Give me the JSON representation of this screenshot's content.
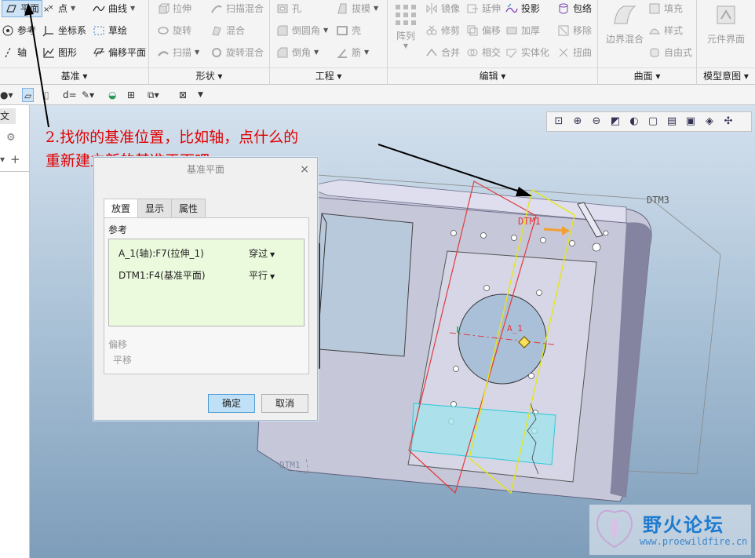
{
  "ribbon": {
    "datum": {
      "label": "基准",
      "plane": "平面",
      "point": "点",
      "curve": "曲线",
      "reference": "参考",
      "csys": "坐标系",
      "sketch": "草绘",
      "axis": "轴",
      "graph": "图形",
      "offset_plane": "偏移平面"
    },
    "shapes": {
      "label": "形状",
      "extrude": "拉伸",
      "sweep_blend": "扫描混合",
      "revolve": "旋转",
      "blend": "混合",
      "sweep": "扫描",
      "rotational_blend": "旋转混合"
    },
    "engineering": {
      "label": "工程",
      "hole": "孔",
      "draft": "拔模",
      "round": "倒圆角",
      "shell": "壳",
      "chamfer": "倒角",
      "rib": "筋"
    },
    "editing": {
      "label": "编辑",
      "pattern": "阵列",
      "mirror": "镜像",
      "extend": "延伸",
      "project": "投影",
      "wrap": "包络",
      "trim": "修剪",
      "offset": "偏移",
      "thicken": "加厚",
      "remove": "移除",
      "merge": "合并",
      "intersect": "相交",
      "solidify": "实体化",
      "twist": "扭曲"
    },
    "surfaces": {
      "label": "曲面",
      "boundary_blend": "边界混合",
      "fill": "填充",
      "style": "样式",
      "freestyle": "自由式"
    },
    "model_intent": {
      "label": "模型意图",
      "component_interface": "元件界面"
    }
  },
  "left_panel": {
    "tab_label": "文夹"
  },
  "annotation": {
    "line1": "2.找你的基准位置，比如轴，点什么的",
    "line2": "重新建立新的基准平面吧"
  },
  "dialog": {
    "title": "基准平面",
    "tabs": [
      "放置",
      "显示",
      "属性"
    ],
    "active_tab": "放置",
    "references_label": "参考",
    "references": [
      {
        "ref": "A_1(轴):F7(拉伸_1)",
        "constraint": "穿过"
      },
      {
        "ref": "DTM1:F4(基准平面)",
        "constraint": "平行"
      }
    ],
    "offset_label": "偏移",
    "translation_label": "平移",
    "ok": "确定",
    "cancel": "取消"
  },
  "viewport": {
    "labels": {
      "dtm3": "DTM3",
      "dtm1": "DTM1",
      "axis": "A_1",
      "dtm_bottom": "DTM1"
    }
  },
  "watermark": {
    "text": "野火论坛",
    "url": "www.proewildfire.cn"
  },
  "colors": {
    "annotation": "#e00000",
    "ok_button": "#bfe0f7",
    "reference_list_bg": "#ebf9dc",
    "new_plane": "#e6e61a",
    "ref_plane": "#e23a3a"
  }
}
